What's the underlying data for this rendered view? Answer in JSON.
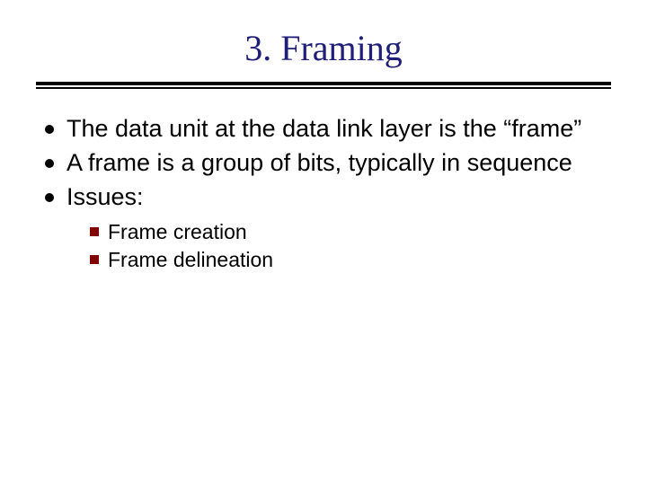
{
  "title": "3. Framing",
  "bullets": [
    "The data unit at the data link layer is the “frame”",
    "A frame is a group of bits, typically in sequence",
    "Issues:"
  ],
  "subBullets": [
    "Frame creation",
    "Frame delineation"
  ]
}
